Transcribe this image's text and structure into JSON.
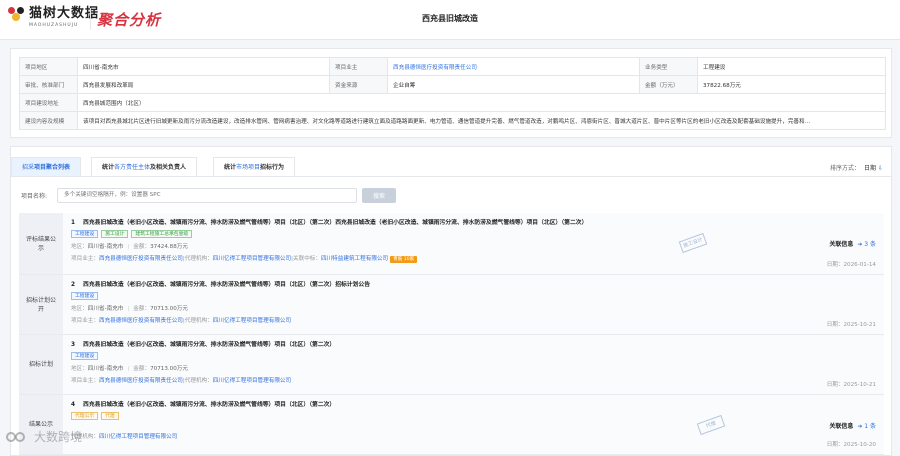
{
  "header": {
    "logo_name": "猫树大数据",
    "logo_sub": "MAOHUZASHUJU",
    "module_title": "聚合分析",
    "page_title": "西充县旧城改造"
  },
  "info": {
    "rows": [
      [
        {
          "label": "项目地区",
          "value": "四川省-南充市"
        },
        {
          "label": "项目业主",
          "value": "西充县德恒医疗投资有限责任公司",
          "link": true
        },
        {
          "label": "业务类型",
          "value": "工程建设"
        }
      ],
      [
        {
          "label": "审批、核准部门",
          "value": "西充县发展和改革局"
        },
        {
          "label": "资金来源",
          "value": "企业自筹"
        },
        {
          "label": "金额（万元）",
          "value": "37822.68万元"
        }
      ]
    ],
    "address_label": "项目建设地址",
    "address_value": "西充县城范围内（北区）",
    "content_label": "建设内容及规模",
    "content_value": "该项目对西充县城北片区进行旧城更新及雨污分流改造建设，改造排水管网、管网病害治理、对文化路等道路进行建筑立面及道路路面更新、电力管道、通信管道提升完善、燃气管道改造，对鹏鸣片区、鸿恩街片区、晋城大道片区、晋中片区等片区的老旧小区改造及配套基础设施提升，完善和…"
  },
  "tabs": [
    {
      "prefix": "招采",
      "label": "项目聚合列表"
    },
    {
      "prefix": "统计",
      "hl": "各方责任主体",
      "suffix": "及相关负责人"
    },
    {
      "prefix": "统计",
      "hl": "市场项目",
      "suffix": "招标行为"
    }
  ],
  "sort": {
    "label": "排序方式：",
    "value": "日期",
    "arrow": "⇩"
  },
  "search": {
    "label": "项目名称:",
    "placeholder": "多个关键词空格隔开，例：设置器 SPC",
    "button": "搜索"
  },
  "items": [
    {
      "stage": "评标结果公示",
      "num": "1",
      "title": "西充县旧城改造（老旧小区改造、城镇雨污分流、排水防涝及燃气管线等）项目（北区）（第二次）西充县旧城改造（老旧小区改造、城镇雨污分流、排水防涝及燃气管线等）项目（北区）（第二次）",
      "tags": [
        {
          "text": "工程建设",
          "type": "blue"
        },
        {
          "text": "施工设计",
          "type": "green"
        },
        {
          "text": "建筑工程施工总承包壹级",
          "type": "green"
        }
      ],
      "region_label": "地区：",
      "region": "四川省-南充市",
      "amount_label": "金额：",
      "amount": "37424.88万元",
      "owner_label": "项目业主：",
      "owner": "西充县德恒医疗投资有限责任公司",
      "agent_label": "代理机构：",
      "agent": "四川亿得工程项目管理有限公司",
      "winner_label": "关联中标：",
      "winner": "四川特益建筑工程有限公司",
      "pill": "青筋 10家",
      "related": "关联信息",
      "related_count": "➔ 3 条",
      "stamp": "施工设计",
      "date_label": "日期：",
      "date": "2026-01-14"
    },
    {
      "stage": "招标计划公开",
      "num": "2",
      "title": "西充县旧城改造（老旧小区改造、城镇雨污分流、排水防涝及燃气管线等）项目（北区）（第二次）招标计划公告",
      "tags": [
        {
          "text": "工程建设",
          "type": "blue"
        }
      ],
      "region_label": "地区：",
      "region": "四川省-南充市",
      "amount_label": "金额：",
      "amount": "70713.00万元",
      "owner_label": "项目业主：",
      "owner": "西充县德恒医疗投资有限责任公司",
      "agent_label": "代理机构：",
      "agent": "四川亿得工程项目管理有限公司",
      "date_label": "日期：",
      "date": "2025-10-21"
    },
    {
      "stage": "招标计划",
      "num": "3",
      "title": "西充县旧城改造（老旧小区改造、城镇雨污分流、排水防涝及燃气管线等）项目（北区）（第二次）",
      "tags": [
        {
          "text": "工程建设",
          "type": "blue"
        }
      ],
      "region_label": "地区：",
      "region": "四川省-南充市",
      "amount_label": "金额：",
      "amount": "70713.00万元",
      "owner_label": "项目业主：",
      "owner": "西充县德恒医疗投资有限责任公司",
      "agent_label": "代理机构：",
      "agent": "四川亿得工程项目管理有限公司",
      "date_label": "日期：",
      "date": "2025-10-21"
    },
    {
      "stage": "结果公示",
      "num": "4",
      "title": "西充县旧城改造（老旧小区改造、城镇雨污分流、排水防涝及燃气管线等）项目（北区）（第二次）",
      "tags": [
        {
          "text": "代理公示",
          "type": "orange"
        },
        {
          "text": "代建",
          "type": "orange"
        }
      ],
      "agent_label": "代理机构：",
      "agent": "四川亿得工程项目管理有限公司",
      "related": "关联信息",
      "related_count": "➔ 1 条",
      "stamp": "代理",
      "date_label": "日期：",
      "date": "2025-10-20"
    }
  ],
  "watermark": "大数跨境",
  "colors": {
    "brand": "#d9333f",
    "link": "#2f6fde",
    "tag_orange": "#e09b1e"
  }
}
